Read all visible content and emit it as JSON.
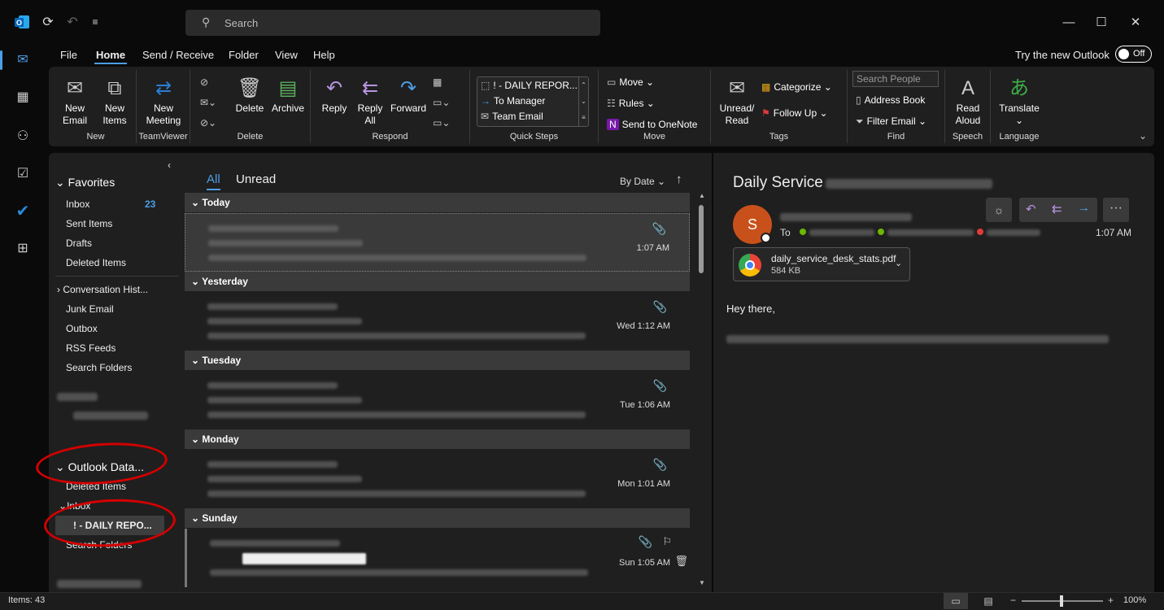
{
  "search": {
    "placeholder": "Search"
  },
  "menu": {
    "items": [
      "File",
      "Home",
      "Send / Receive",
      "Folder",
      "View",
      "Help"
    ],
    "active": "Home",
    "try_new": "Try the new Outlook",
    "toggle": "Off"
  },
  "ribbon": {
    "new": {
      "email": "New Email",
      "items": "New Items",
      "label": "New"
    },
    "teamviewer": {
      "meeting": "New Meeting",
      "label": "TeamViewer"
    },
    "delete": {
      "delete": "Delete",
      "archive": "Archive",
      "label": "Delete"
    },
    "respond": {
      "reply": "Reply",
      "reply_all": "Reply All",
      "forward": "Forward",
      "label": "Respond"
    },
    "quicksteps": {
      "items": [
        "! - DAILY REPOR...",
        "To Manager",
        "Team Email"
      ],
      "label": "Quick Steps"
    },
    "move": {
      "move": "Move",
      "rules": "Rules",
      "onenote": "Send to OneNote",
      "label": "Move"
    },
    "tags": {
      "unread": "Unread/ Read",
      "categorize": "Categorize",
      "followup": "Follow Up",
      "label": "Tags"
    },
    "find": {
      "search_people": "Search People",
      "address_book": "Address Book",
      "filter_email": "Filter Email",
      "label": "Find"
    },
    "speech": {
      "read_aloud": "Read Aloud",
      "label": "Speech"
    },
    "language": {
      "translate": "Translate",
      "label": "Language"
    }
  },
  "nav": {
    "favorites": "Favorites",
    "fav_items": [
      {
        "label": "Inbox",
        "count": "23"
      },
      {
        "label": "Sent Items"
      },
      {
        "label": "Drafts"
      },
      {
        "label": "Deleted Items"
      }
    ],
    "conversation": "Conversation Hist...",
    "folders": [
      "Junk Email",
      "Outbox",
      "RSS Feeds",
      "Search Folders"
    ],
    "outlook_data": "Outlook Data...",
    "od_items": [
      "Deleted Items",
      "Inbox"
    ],
    "selected_item": "! - DAILY REPO...",
    "search_folders": "Search Folders"
  },
  "list": {
    "tabs": {
      "all": "All",
      "unread": "Unread"
    },
    "sort": "By Date",
    "groups": [
      {
        "label": "Today",
        "time": "1:07 AM"
      },
      {
        "label": "Yesterday",
        "time": "Wed 1:12 AM"
      },
      {
        "label": "Tuesday",
        "time": "Tue 1:06 AM"
      },
      {
        "label": "Monday",
        "time": "Mon 1:01 AM"
      },
      {
        "label": "Sunday",
        "time": "Sun 1:05 AM"
      }
    ]
  },
  "reading": {
    "subject": "Daily Service",
    "avatar_letter": "S",
    "to_label": "To",
    "time": "1:07 AM",
    "attachment": {
      "name": "daily_service_desk_stats.pdf",
      "size": "584 KB"
    },
    "greeting": "Hey there,"
  },
  "status": {
    "items": "Items: 43",
    "zoom": "100%"
  },
  "colors": {
    "accent": "#4c9ee8",
    "avatar": "#c8511b",
    "highlight_circle": "#d40000"
  }
}
